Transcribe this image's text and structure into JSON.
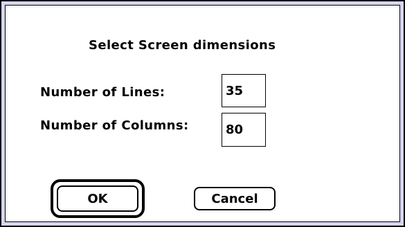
{
  "dialog": {
    "title": "Select Screen dimensions",
    "fields": {
      "lines": {
        "label": "Number of Lines:",
        "value": "35"
      },
      "columns": {
        "label": "Number of Columns:",
        "value": "80"
      }
    },
    "buttons": {
      "ok_label": "OK",
      "cancel_label": "Cancel"
    }
  },
  "colors": {
    "frame": "#000000",
    "frame_inner_band": "#d6d6f0",
    "background": "#ffffff",
    "text": "#000000"
  }
}
